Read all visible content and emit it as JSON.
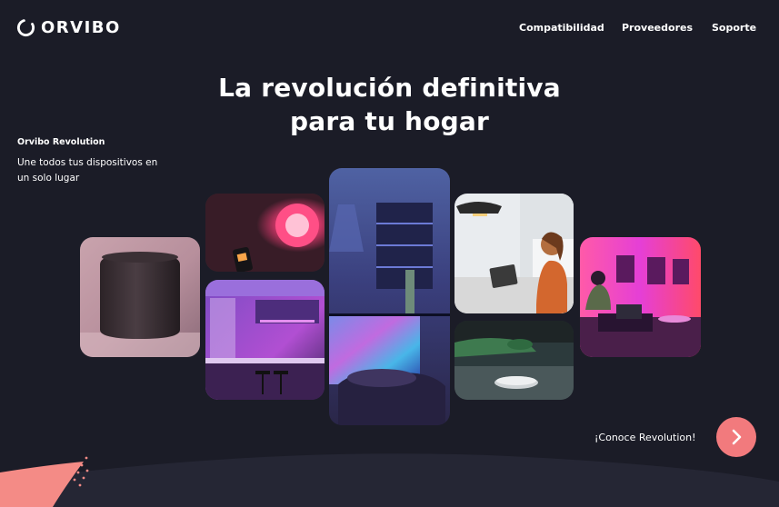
{
  "brand": {
    "name": "ORVIBO"
  },
  "nav": {
    "items": [
      {
        "label": "Compatibilidad"
      },
      {
        "label": "Proveedores"
      },
      {
        "label": "Soporte"
      }
    ]
  },
  "hero": {
    "title_line1": "La revolución definitiva",
    "title_line2": "para tu hogar"
  },
  "tagline": {
    "title": "Orvibo Revolution",
    "description": "Une todos tus dispositivos en un solo lugar"
  },
  "cta": {
    "label": "¡Conoce Revolution!",
    "icon": "chevron-right-icon"
  },
  "colors": {
    "background": "#1b1c27",
    "accent": "#f27a7d",
    "text": "#ffffff"
  }
}
